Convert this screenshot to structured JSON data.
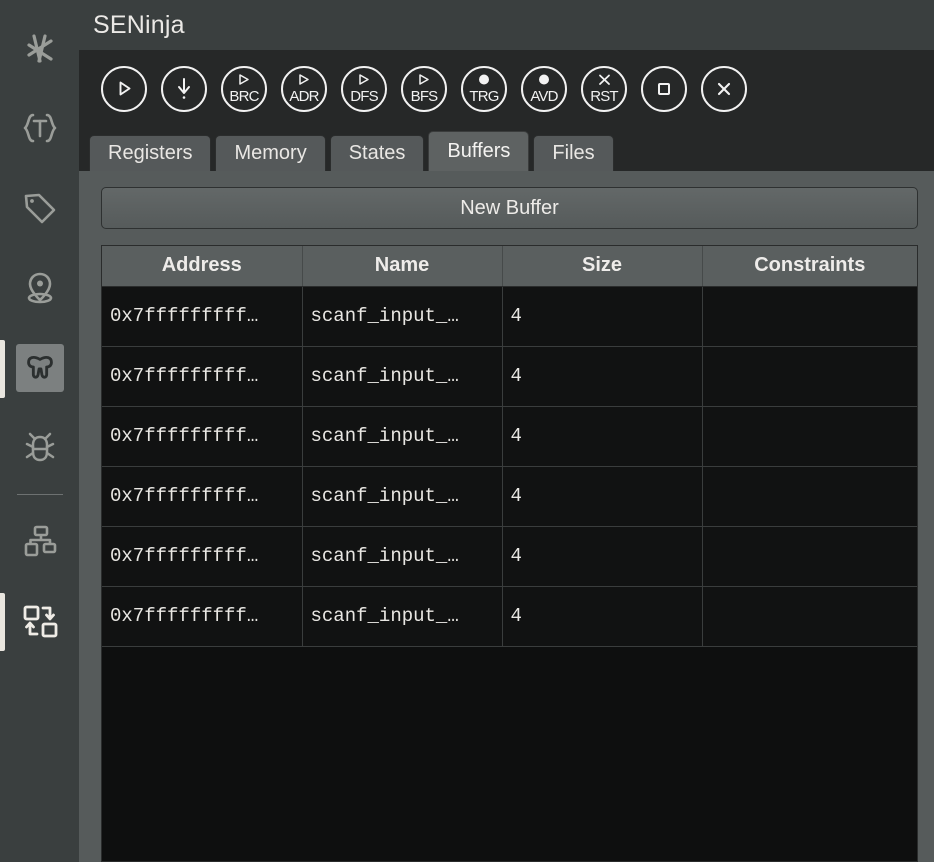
{
  "window": {
    "title": "SENinja"
  },
  "sidebar": {
    "items": [
      {
        "name": "hash-icon",
        "icon": "hash",
        "selected": false,
        "active_bar": false
      },
      {
        "name": "types-icon",
        "icon": "types",
        "selected": false,
        "active_bar": false
      },
      {
        "name": "tag-icon",
        "icon": "tag",
        "selected": false,
        "active_bar": false
      },
      {
        "name": "location-icon",
        "icon": "location",
        "selected": false,
        "active_bar": false
      },
      {
        "name": "ninja-icon",
        "icon": "ninja",
        "selected": true,
        "active_bar": true
      },
      {
        "name": "bug-icon",
        "icon": "bug",
        "selected": false,
        "active_bar": false
      },
      {
        "name": "hierarchy-icon",
        "icon": "hierarchy",
        "selected": false,
        "active_bar": false
      },
      {
        "name": "transfer-icon",
        "icon": "transfer",
        "selected": false,
        "active_bar": true
      }
    ]
  },
  "toolbar": {
    "buttons": [
      {
        "name": "run-button",
        "label": "",
        "glyph": "play",
        "title": "Run"
      },
      {
        "name": "step-button",
        "label": "",
        "glyph": "arrow-down",
        "title": "Step"
      },
      {
        "name": "run-branch-button",
        "label": "BRC",
        "glyph": "play-mini",
        "title": "Run until branch"
      },
      {
        "name": "run-address-button",
        "label": "ADR",
        "glyph": "play-mini",
        "title": "Run to address"
      },
      {
        "name": "dfs-button",
        "label": "DFS",
        "glyph": "play-mini",
        "title": "Depth first search"
      },
      {
        "name": "bfs-button",
        "label": "BFS",
        "glyph": "play-mini",
        "title": "Breadth first search"
      },
      {
        "name": "target-button",
        "label": "TRG",
        "glyph": "dot",
        "title": "Set target"
      },
      {
        "name": "avoid-button",
        "label": "AVD",
        "glyph": "dot",
        "title": "Set avoid"
      },
      {
        "name": "reset-button",
        "label": "RST",
        "glyph": "cross-mini",
        "title": "Reset targets"
      },
      {
        "name": "stop-button",
        "label": "",
        "glyph": "square",
        "title": "Stop"
      },
      {
        "name": "close-button",
        "label": "",
        "glyph": "cross",
        "title": "Close"
      }
    ]
  },
  "tabs": [
    {
      "label": "Registers",
      "active": false
    },
    {
      "label": "Memory",
      "active": false
    },
    {
      "label": "States",
      "active": false
    },
    {
      "label": "Buffers",
      "active": true
    },
    {
      "label": "Files",
      "active": false
    }
  ],
  "buffers_panel": {
    "new_buffer_label": "New Buffer",
    "columns": [
      "Address",
      "Name",
      "Size",
      "Constraints"
    ],
    "rows": [
      {
        "address": "0x7fffffffff…",
        "name": "scanf_input_…",
        "size": "4",
        "constraints": ""
      },
      {
        "address": "0x7fffffffff…",
        "name": "scanf_input_…",
        "size": "4",
        "constraints": ""
      },
      {
        "address": "0x7fffffffff…",
        "name": "scanf_input_…",
        "size": "4",
        "constraints": ""
      },
      {
        "address": "0x7fffffffff…",
        "name": "scanf_input_…",
        "size": "4",
        "constraints": ""
      },
      {
        "address": "0x7fffffffff…",
        "name": "scanf_input_…",
        "size": "4",
        "constraints": ""
      },
      {
        "address": "0x7fffffffff…",
        "name": "scanf_input_…",
        "size": "4",
        "constraints": ""
      }
    ]
  },
  "colors": {
    "sidebar_bg": "#3a3f3f",
    "toolbar_bg": "#262828",
    "panel_bg": "#565b5b",
    "table_bg": "#111212",
    "header_bg": "#5a5f5f",
    "accent_indicator": "#e9e6df",
    "text": "#e9e7e3"
  }
}
